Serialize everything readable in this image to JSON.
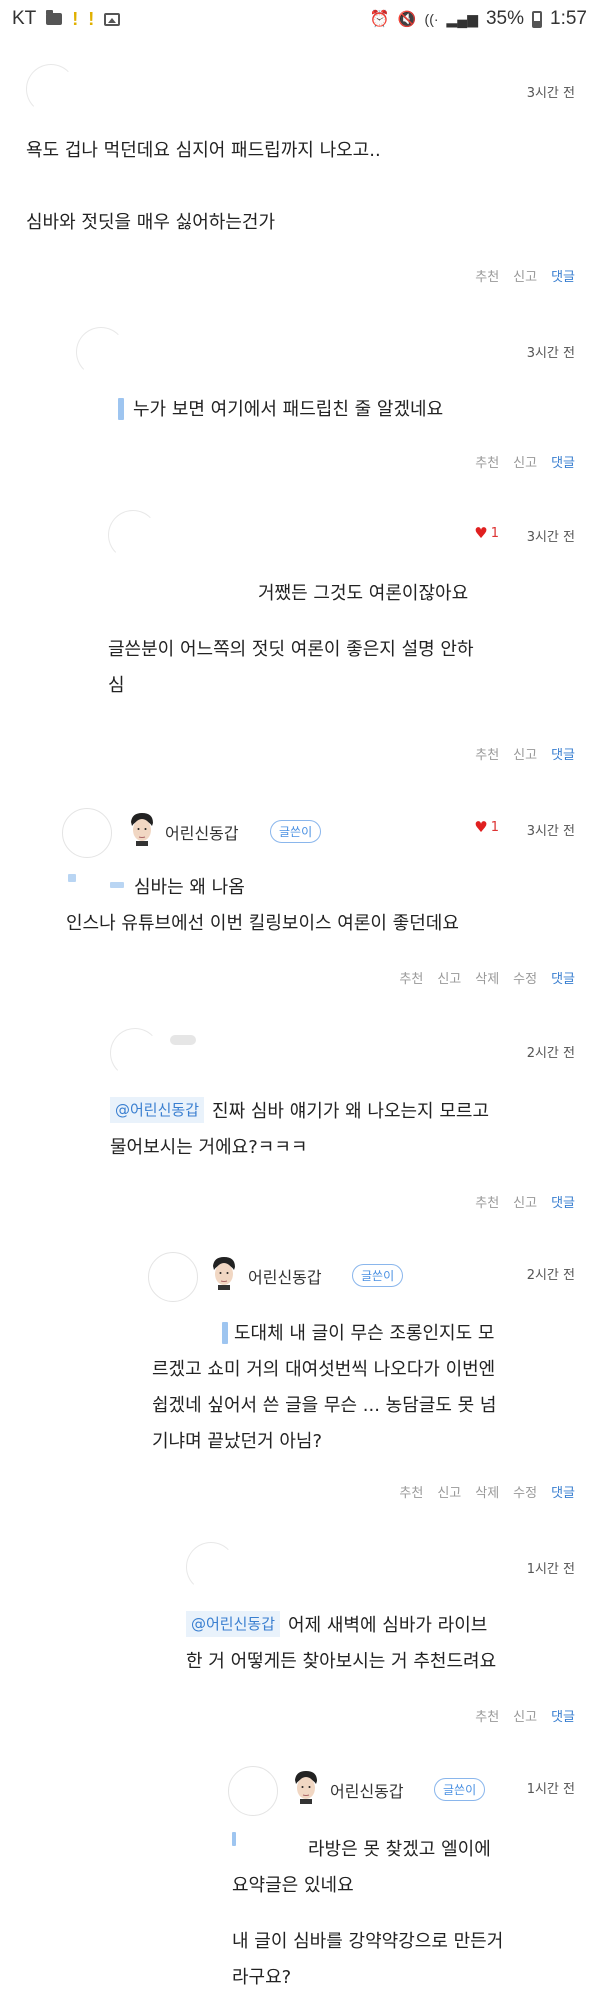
{
  "status_bar": {
    "carrier": "KT",
    "battery_percent": "35%",
    "time": "1:57"
  },
  "actions": {
    "recommend": "추천",
    "report": "신고",
    "delete": "삭제",
    "edit": "수정",
    "reply": "댓글"
  },
  "author_badge": "글쓴이",
  "comments": [
    {
      "time": "3시간 전",
      "lines": [
        "욕도 겁나 먹던데요 심지어 패드립까지 나오고..",
        "",
        "심바와 젓딧을 매우 싫어하는건가"
      ]
    },
    {
      "time": "3시간 전",
      "lines": [
        "누가 보면 여기에서 패드립친 줄 알겠네요"
      ]
    },
    {
      "likes": "1",
      "time": "3시간 전",
      "lines": [
        "거쨌든 그것도 여론이잖아요",
        "",
        "글쓴분이 어느쪽의 젓딧 여론이 좋은지 설명 안하",
        "심"
      ]
    },
    {
      "nickname": "어린신동갑",
      "likes": "1",
      "time": "3시간 전",
      "lines": [
        "심바는 왜 나옴",
        "인스나 유튜브에선 이번 킬링보이스 여론이 좋던데요"
      ]
    },
    {
      "time": "2시간 전",
      "mention": "@어린신동갑",
      "lines": [
        "진짜 심바 얘기가 왜 나오는지 모르고",
        "물어보시는 거에요?ㅋㅋㅋ"
      ]
    },
    {
      "nickname": "어린신동갑",
      "time": "2시간 전",
      "lines": [
        "도대체 내 글이 무슨 조롱인지도 모",
        "르겠고 쇼미 거의 대여섯번씩 나오다가 이번엔",
        "쉽겠네 싶어서 쓴 글을 무슨 ... 농담글도 못 넘",
        "기냐며 끝났던거 아님?"
      ]
    },
    {
      "time": "1시간 전",
      "mention": "@어린신동갑",
      "lines": [
        "어제 새벽에 심바가 라이브",
        "한 거 어떻게든 찾아보시는 거 추천드려요"
      ]
    },
    {
      "nickname": "어린신동갑",
      "time": "1시간 전",
      "lines": [
        "라방은 못 찾겠고 엘이에",
        "요약글은 있네요",
        "",
        "내 글이 심바를 강약약강으로 만든거",
        "라구요?"
      ]
    }
  ]
}
